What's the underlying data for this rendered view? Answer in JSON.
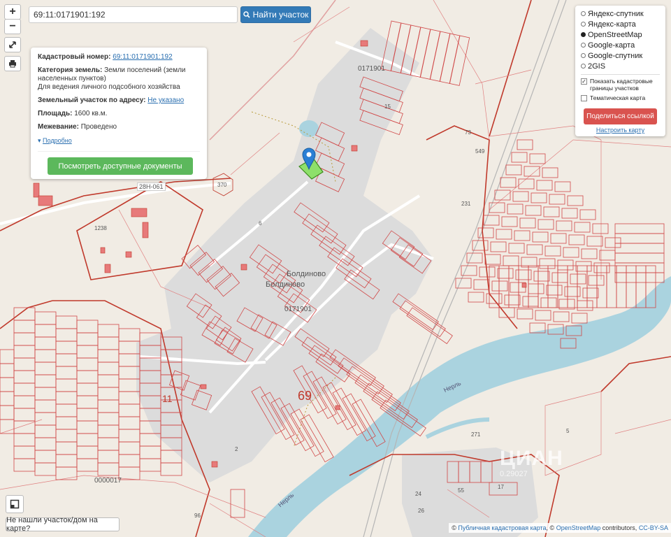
{
  "map": {
    "zoom_in": "+",
    "zoom_out": "−",
    "labels": {
      "village_1": "Болдиново",
      "village_2": "Болдиново",
      "block_top": "0171901",
      "block_mid": "0171901",
      "block_bottom": "0000017",
      "district_69": "69",
      "district_11": "11",
      "road_28n": "28Н-061",
      "river": "Нерль",
      "river_2": "Нерль",
      "lot_549": "549",
      "lot_231": "231",
      "lot_73": "73",
      "lot_370": "370",
      "lot_1238": "1238",
      "lot_271": "271",
      "lot_5": "5",
      "lot_96": "96",
      "lot_24": "24",
      "lot_55": "55",
      "lot_17": "17",
      "lot_6": "6",
      "lot_26": "26",
      "lot_2": "2",
      "lot_15": "15"
    }
  },
  "search": {
    "value": "69:11:0171901:192",
    "button_label": "Найти участок"
  },
  "info": {
    "cad_label": "Кадастровый номер:",
    "cad_value": "69:11:0171901:192",
    "category_label": "Категория земель:",
    "category_value": "Земли поселений (земли населенных пунктов)",
    "category_use": "Для ведения личного подсобного хозяйства",
    "address_label": "Земельный участок по адресу:",
    "address_value": "Не указано",
    "area_label": "Площадь:",
    "area_value": "1600 кв.м.",
    "survey_label": "Межевание:",
    "survey_value": "Проведено",
    "more_link": "Подробно",
    "docs_button": "Посмотреть доступные документы"
  },
  "layers": {
    "options": [
      {
        "label": "Яндекс-спутник",
        "selected": false
      },
      {
        "label": "Яндекс-карта",
        "selected": false
      },
      {
        "label": "OpenStreetMap",
        "selected": true
      },
      {
        "label": "Google-карта",
        "selected": false
      },
      {
        "label": "Google-спутник",
        "selected": false
      },
      {
        "label": "2GIS",
        "selected": false
      }
    ],
    "show_borders": "Показать кадастровые границы участков",
    "thematic": "Тематическая карта",
    "share_button": "Поделиться ссылкой",
    "configure_link": "Настроить карту"
  },
  "bottom": {
    "not_found": "Не нашли участок/дом на карте?"
  },
  "attribution": {
    "copy1": "©",
    "pkk": "Публичная кадастровая карта",
    "sep": ", ©",
    "osm": "OpenStreetMap",
    "contributors": "contributors,",
    "license": "CC-BY-SA"
  },
  "watermark": {
    "brand": "ЦИАН",
    "id": "0.29027"
  },
  "colors": {
    "land": "#f1ece4",
    "settlement": "#dcdcdc",
    "water": "#aad3df",
    "parcel_border": "#d23c3c",
    "selected_parcel": "#8ee06a",
    "marker": "#2a7fd4"
  }
}
